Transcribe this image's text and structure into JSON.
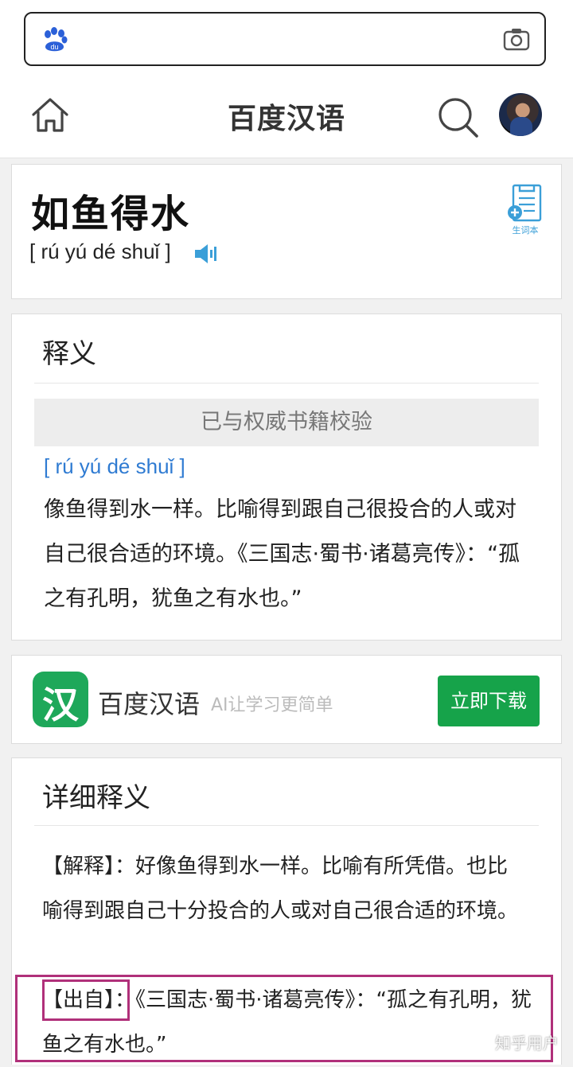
{
  "search": {
    "logo_icon": "baidu-paw-icon",
    "logo_text": "du",
    "camera_icon": "camera-icon"
  },
  "header": {
    "title": "百度汉语",
    "home_icon": "home-icon",
    "search_icon": "search-icon"
  },
  "word": {
    "title": "如鱼得水",
    "pinyin": "[ rú yú dé shuǐ ]",
    "vocab_label": "生词本",
    "accent_color": "#3b9fd8"
  },
  "meaning": {
    "section_title": "释义",
    "verified": "已与权威书籍校验",
    "pinyin": "[ rú yú dé shuǐ ]",
    "text": "像鱼得到水一样。比喻得到跟自己很投合的人或对自己很合适的环境。《三国志·蜀书·诸葛亮传》：“孤之有孔明，犹鱼之有水也。”"
  },
  "ad": {
    "logo_char": "汉",
    "name": "百度汉语",
    "slogan": "AI让学习更简单",
    "button": "立即下载",
    "button_color": "#16a34a"
  },
  "detail": {
    "section_title": "详细释义",
    "explain_label": "【解释】",
    "explain_text": "：好像鱼得到水一样。比喻有所凭借。也比喻得到跟自己十分投合的人或对自己很合适的环境。",
    "source_label": "【出自】",
    "source_text": "：《三国志·蜀书·诸葛亮传》：“孤之有孔明，犹鱼之有水也。”",
    "highlight_color": "#b0307a"
  },
  "watermark": "知乎用户"
}
